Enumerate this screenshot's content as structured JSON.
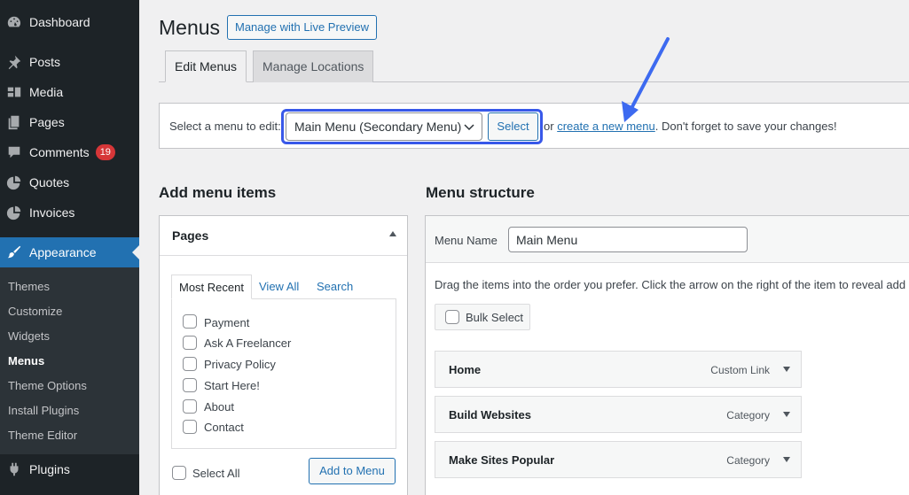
{
  "sidebar": {
    "items": [
      {
        "label": "Dashboard",
        "icon": "dashboard-icon"
      },
      {
        "label": "Posts",
        "icon": "pin-icon"
      },
      {
        "label": "Media",
        "icon": "media-icon"
      },
      {
        "label": "Pages",
        "icon": "pages-icon"
      },
      {
        "label": "Comments",
        "icon": "comment-icon",
        "badge": "19"
      },
      {
        "label": "Quotes",
        "icon": "pie-icon"
      },
      {
        "label": "Invoices",
        "icon": "pie-icon"
      },
      {
        "label": "Appearance",
        "icon": "brush-icon",
        "active": true
      },
      {
        "label": "Plugins",
        "icon": "plugin-icon"
      }
    ],
    "submenu": [
      "Themes",
      "Customize",
      "Widgets",
      "Menus",
      "Theme Options",
      "Install Plugins",
      "Theme Editor"
    ],
    "current_submenu": "Menus"
  },
  "header": {
    "title": "Menus",
    "live_preview": "Manage with Live Preview"
  },
  "tabs": [
    "Edit Menus",
    "Manage Locations"
  ],
  "select_bar": {
    "label": "Select a menu to edit:",
    "selected_menu": "Main Menu (Secondary Menu)",
    "select_button": "Select",
    "or_text": "or",
    "create_link": "create a new menu",
    "tail_text": ". Don't forget to save your changes!"
  },
  "add_items": {
    "heading": "Add menu items",
    "box_title": "Pages",
    "tabs": [
      "Most Recent",
      "View All",
      "Search"
    ],
    "pages": [
      "Payment",
      "Ask A Freelancer",
      "Privacy Policy",
      "Start Here!",
      "About",
      "Contact"
    ],
    "select_all": "Select All",
    "add_button": "Add to Menu"
  },
  "structure": {
    "heading": "Menu structure",
    "name_label": "Menu Name",
    "name_value": "Main Menu",
    "instructions": "Drag the items into the order you prefer. Click the arrow on the right of the item to reveal add",
    "bulk_select": "Bulk Select",
    "items": [
      {
        "title": "Home",
        "type": "Custom Link"
      },
      {
        "title": "Build Websites",
        "type": "Category"
      },
      {
        "title": "Make Sites Popular",
        "type": "Category"
      }
    ]
  },
  "colors": {
    "sidebar_bg": "#1d2327",
    "accent": "#2271b1",
    "highlight": "#3858e9",
    "badge": "#d63638"
  }
}
